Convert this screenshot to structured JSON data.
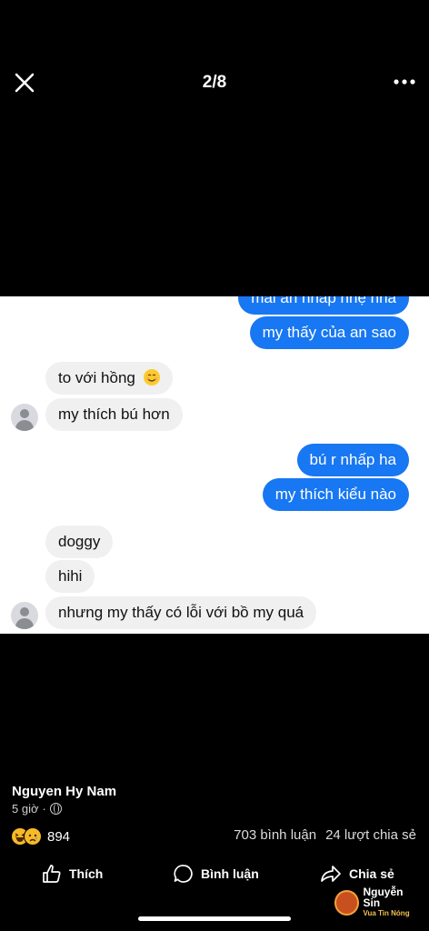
{
  "viewer": {
    "counter": "2/8",
    "close_icon": "close-icon",
    "more_icon": "more-horizontal-icon"
  },
  "chat": {
    "messages": [
      {
        "side": "out",
        "text": "mai an nhap nhẹ nha"
      },
      {
        "side": "out",
        "text": "my thấy của an sao"
      },
      {
        "side": "in",
        "text": "to với hồng",
        "emoji": "smiling-face-emoji"
      },
      {
        "side": "in",
        "text": "my thích bú hơn"
      },
      {
        "side": "out",
        "text": "bú r nhấp ha"
      },
      {
        "side": "out",
        "text": "my thích kiểu nào"
      },
      {
        "side": "in",
        "text": "doggy"
      },
      {
        "side": "in",
        "text": "hihi"
      },
      {
        "side": "in",
        "text": "nhưng my thấy có lỗi với bồ my quá"
      }
    ],
    "colors": {
      "outgoing": "#1877f2",
      "incoming": "#f0f0f0"
    }
  },
  "post": {
    "author": "Nguyen Hy Nam",
    "time": "5 giờ",
    "separator": "·",
    "audience_icon": "globe-icon",
    "reaction_count": "894",
    "reaction_icons": [
      "haha-reaction-icon",
      "sad-reaction-icon"
    ],
    "comments": "703 bình luận",
    "shares": "24 lượt chia sẻ"
  },
  "actions": {
    "like": "Thích",
    "comment": "Bình luận",
    "share": "Chia sẻ"
  },
  "watermark": {
    "name": "Nguyễn Sin",
    "tagline": "Vua Tin Nóng"
  }
}
